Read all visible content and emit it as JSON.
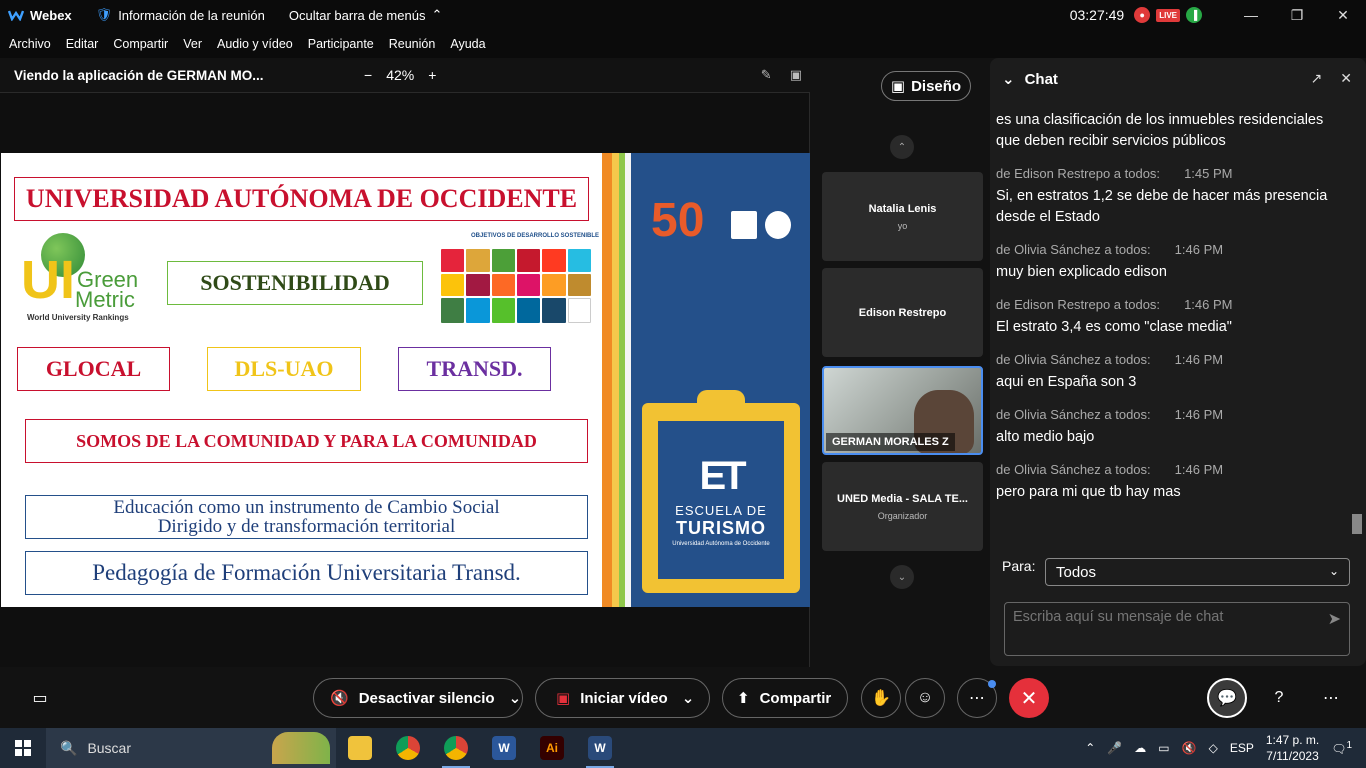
{
  "titlebar": {
    "app_name": "Webex",
    "meeting_info": "Información de la reunión",
    "hide_menu": "Ocultar barra de menús",
    "clock": "03:27:49",
    "live": "LIVE"
  },
  "menu": [
    "Archivo",
    "Editar",
    "Compartir",
    "Ver",
    "Audio y vídeo",
    "Participante",
    "Reunión",
    "Ayuda"
  ],
  "share": {
    "title": "Viendo la aplicación de GERMAN MO...",
    "zoom": "42%"
  },
  "slide": {
    "university": "UNIVERSIDAD AUTÓNOMA DE OCCIDENTE",
    "greenmetric_ui": "UI",
    "greenmetric_green": "Green",
    "greenmetric_metric": "Metric",
    "greenmetric_sub": "World University Rankings",
    "ods_title": "OBJETIVOS DE DESARROLLO SOSTENIBLE",
    "sostenibilidad": "SOSTENIBILIDAD",
    "glocal": "GLOCAL",
    "dls": "DLS-UAO",
    "transd": "TRANSD.",
    "comunidad": "SOMOS DE LA COMUNIDAD Y PARA LA COMUNIDAD",
    "educacion_1": "Educación como un instrumento de Cambio Social",
    "educacion_2": "Dirigido y de transformación territorial",
    "pedagogia": "Pedagogía de Formación Universitaria Transd.",
    "fifty": "50",
    "et": "ET",
    "escuela": "ESCUELA DE",
    "turismo": "TURISMO",
    "escuela_sub": "Universidad Autónoma de Occidente"
  },
  "layout_button": "Diseño",
  "participants": [
    {
      "name": "Natalia Lenis",
      "sub": "yo"
    },
    {
      "name": "Edison Restrepo",
      "sub": ""
    },
    {
      "name": "GERMAN MORALES Z",
      "sub": ""
    },
    {
      "name": "UNED Media - SALA TE...",
      "sub": "Organizador"
    }
  ],
  "chat": {
    "title": "Chat",
    "messages": [
      {
        "from": "",
        "time": "",
        "text": "es una clasificación de los inmuebles residenciales que deben recibir servicios públicos"
      },
      {
        "from": "de Edison Restrepo a todos:",
        "time": "1:45 PM",
        "text": "Si, en estratos 1,2 se debe de hacer más presencia desde el Estado"
      },
      {
        "from": "de Olivia Sánchez a todos:",
        "time": "1:46 PM",
        "text": "muy bien explicado edison"
      },
      {
        "from": "de Edison Restrepo a todos:",
        "time": "1:46 PM",
        "text": "El estrato 3,4 es como \"clase media\""
      },
      {
        "from": "de Olivia Sánchez a todos:",
        "time": "1:46 PM",
        "text": "aqui en España son 3"
      },
      {
        "from": "de Olivia Sánchez a todos:",
        "time": "1:46 PM",
        "text": "alto medio bajo"
      },
      {
        "from": "de Olivia Sánchez a todos:",
        "time": "1:46 PM",
        "text": "pero para mi que tb hay mas"
      }
    ],
    "para_label": "Para:",
    "para_value": "Todos",
    "input_placeholder": "Escriba aquí su mensaje de chat"
  },
  "controls": {
    "mute": "Desactivar silencio",
    "video": "Iniciar vídeo",
    "share": "Compartir"
  },
  "taskbar": {
    "search": "Buscar",
    "lang": "ESP",
    "time": "1:47 p. m.",
    "date": "7/11/2023",
    "notifications": "1"
  },
  "colors": {
    "accent": "#4a8df0",
    "end_call": "#e5303b",
    "slide_navy": "#24508a",
    "slide_red": "#c8102e"
  }
}
